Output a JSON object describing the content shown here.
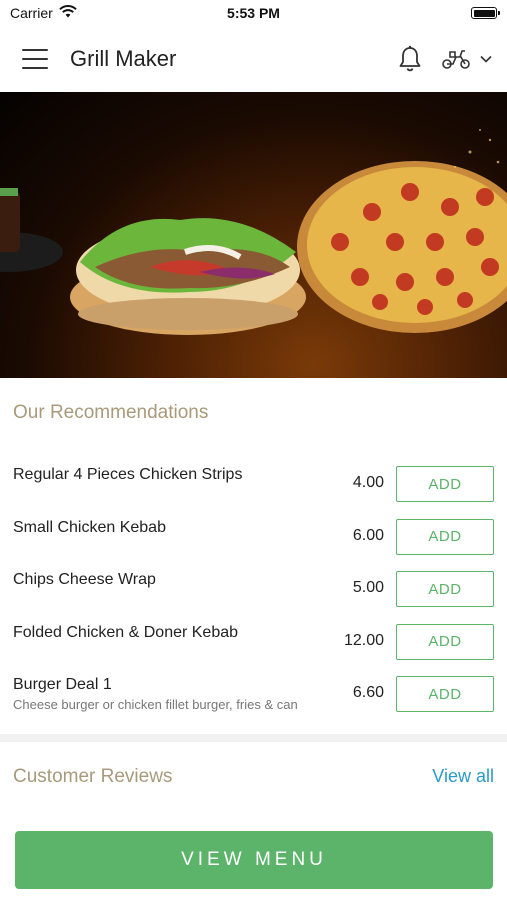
{
  "status_bar": {
    "carrier": "Carrier",
    "time": "5:53 PM"
  },
  "header": {
    "title": "Grill Maker"
  },
  "recommendations": {
    "title": "Our Recommendations",
    "add_label": "ADD",
    "items": [
      {
        "name": "Regular 4 Pieces Chicken Strips",
        "price": "4.00",
        "description": ""
      },
      {
        "name": "Small Chicken Kebab",
        "price": "6.00",
        "description": ""
      },
      {
        "name": "Chips Cheese Wrap",
        "price": "5.00",
        "description": ""
      },
      {
        "name": "Folded Chicken & Doner Kebab",
        "price": "12.00",
        "description": ""
      },
      {
        "name": "Burger Deal 1",
        "price": "6.60",
        "description": "Cheese burger or chicken fillet burger, fries & can"
      }
    ]
  },
  "reviews": {
    "title": "Customer Reviews",
    "view_all": "View all"
  },
  "footer": {
    "view_menu": "VIEW MENU"
  },
  "colors": {
    "accent_green": "#5cb36a",
    "link_blue": "#2a9ac8",
    "section_title": "#a89a7a"
  },
  "icons": [
    "wifi-icon",
    "battery-icon",
    "menu-icon",
    "bell-icon",
    "delivery-scooter-icon",
    "chevron-down-icon"
  ]
}
